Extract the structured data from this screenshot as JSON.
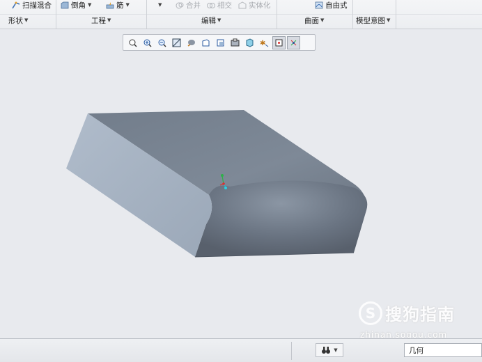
{
  "ribbon": {
    "row1": {
      "sweep_blend": "扫描混合",
      "chamfer": "倒角",
      "rib": "筋",
      "merge": "合并",
      "intersect": "相交",
      "solidify": "实体化",
      "freestyle": "自由式"
    },
    "groups": {
      "shapes": "形状",
      "engineering": "工程",
      "editing": "编辑",
      "surfaces": "曲面",
      "model_intent": "模型意图"
    }
  },
  "view_toolbar": {
    "buttons": [
      "refit-icon",
      "zoom-in-icon",
      "zoom-out-icon",
      "repaint-icon",
      "display-style-icon",
      "saved-views-icon",
      "view-manager-icon",
      "perspective-icon",
      "annotation-display-icon",
      "datum-display-icon",
      "spin-center-icon",
      "csys-display-icon"
    ],
    "active": [
      10,
      11
    ]
  },
  "watermark": {
    "logo": "S",
    "text": "搜狗指南",
    "url": "zhinan.sogou.com"
  },
  "statusbar": {
    "filter_value": "几何"
  },
  "colors": {
    "model_top": "#7a8593",
    "model_side": "#a6b2c1",
    "model_front": "#5f6774",
    "background": "#e8eaee"
  }
}
